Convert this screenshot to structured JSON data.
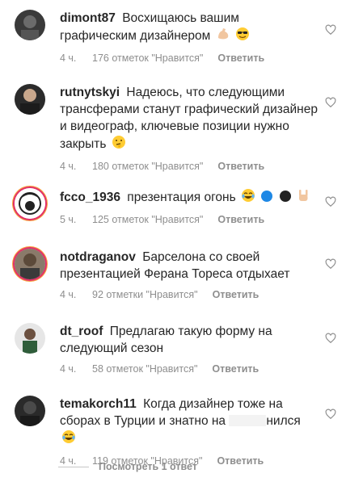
{
  "comments": [
    {
      "username": "dimont87",
      "text": "Восхищаюсь вашим графическим дизайнером",
      "emoji": [
        "flexed-biceps",
        "smiling-face-sunglasses"
      ],
      "time": "4 ч.",
      "likes": "176 отметок \"Нравится\"",
      "reply": "Ответить"
    },
    {
      "username": "rutnytskyi",
      "text": "Надеюсь, что следующими трансферами станут графический дизайнер и видеограф, ключевые позиции нужно закрыть",
      "emoji": [
        "thinking-face"
      ],
      "time": "4 ч.",
      "likes": "180 отметок \"Нравится\"",
      "reply": "Ответить"
    },
    {
      "username": "fcco_1936",
      "text": "презентация огонь",
      "emoji": [
        "tears-of-joy",
        "blue-circle",
        "black-circle",
        "sign-of-horns"
      ],
      "time": "5 ч.",
      "likes": "125 отметок \"Нравится\"",
      "reply": "Ответить"
    },
    {
      "username": "notdraganov",
      "text": "Барселона со своей презентацией Ферана Тореса отдыхает",
      "emoji": [],
      "time": "4 ч.",
      "likes": "92 отметки \"Нравится\"",
      "reply": "Ответить"
    },
    {
      "username": "dt_roof",
      "text": "Предлагаю такую форму на следующий сезон",
      "emoji": [],
      "time": "4 ч.",
      "likes": "58 отметок \"Нравится\"",
      "reply": "Ответить"
    },
    {
      "username": "temakorch11",
      "text_a": "Когда дизайнер тоже на сборах в Турции и знатно на",
      "text_b": "нился",
      "emoji": [
        "tears-of-joy"
      ],
      "time": "4 ч.",
      "likes": "119 отметок \"Нравится\"",
      "reply": "Ответить"
    }
  ],
  "view_replies": "Посмотреть 1 ответ",
  "icons": {
    "like": "heart-outline-icon"
  },
  "colors": {
    "text": "#262626",
    "meta": "#8e8e8e",
    "ring": "#e1306c"
  }
}
